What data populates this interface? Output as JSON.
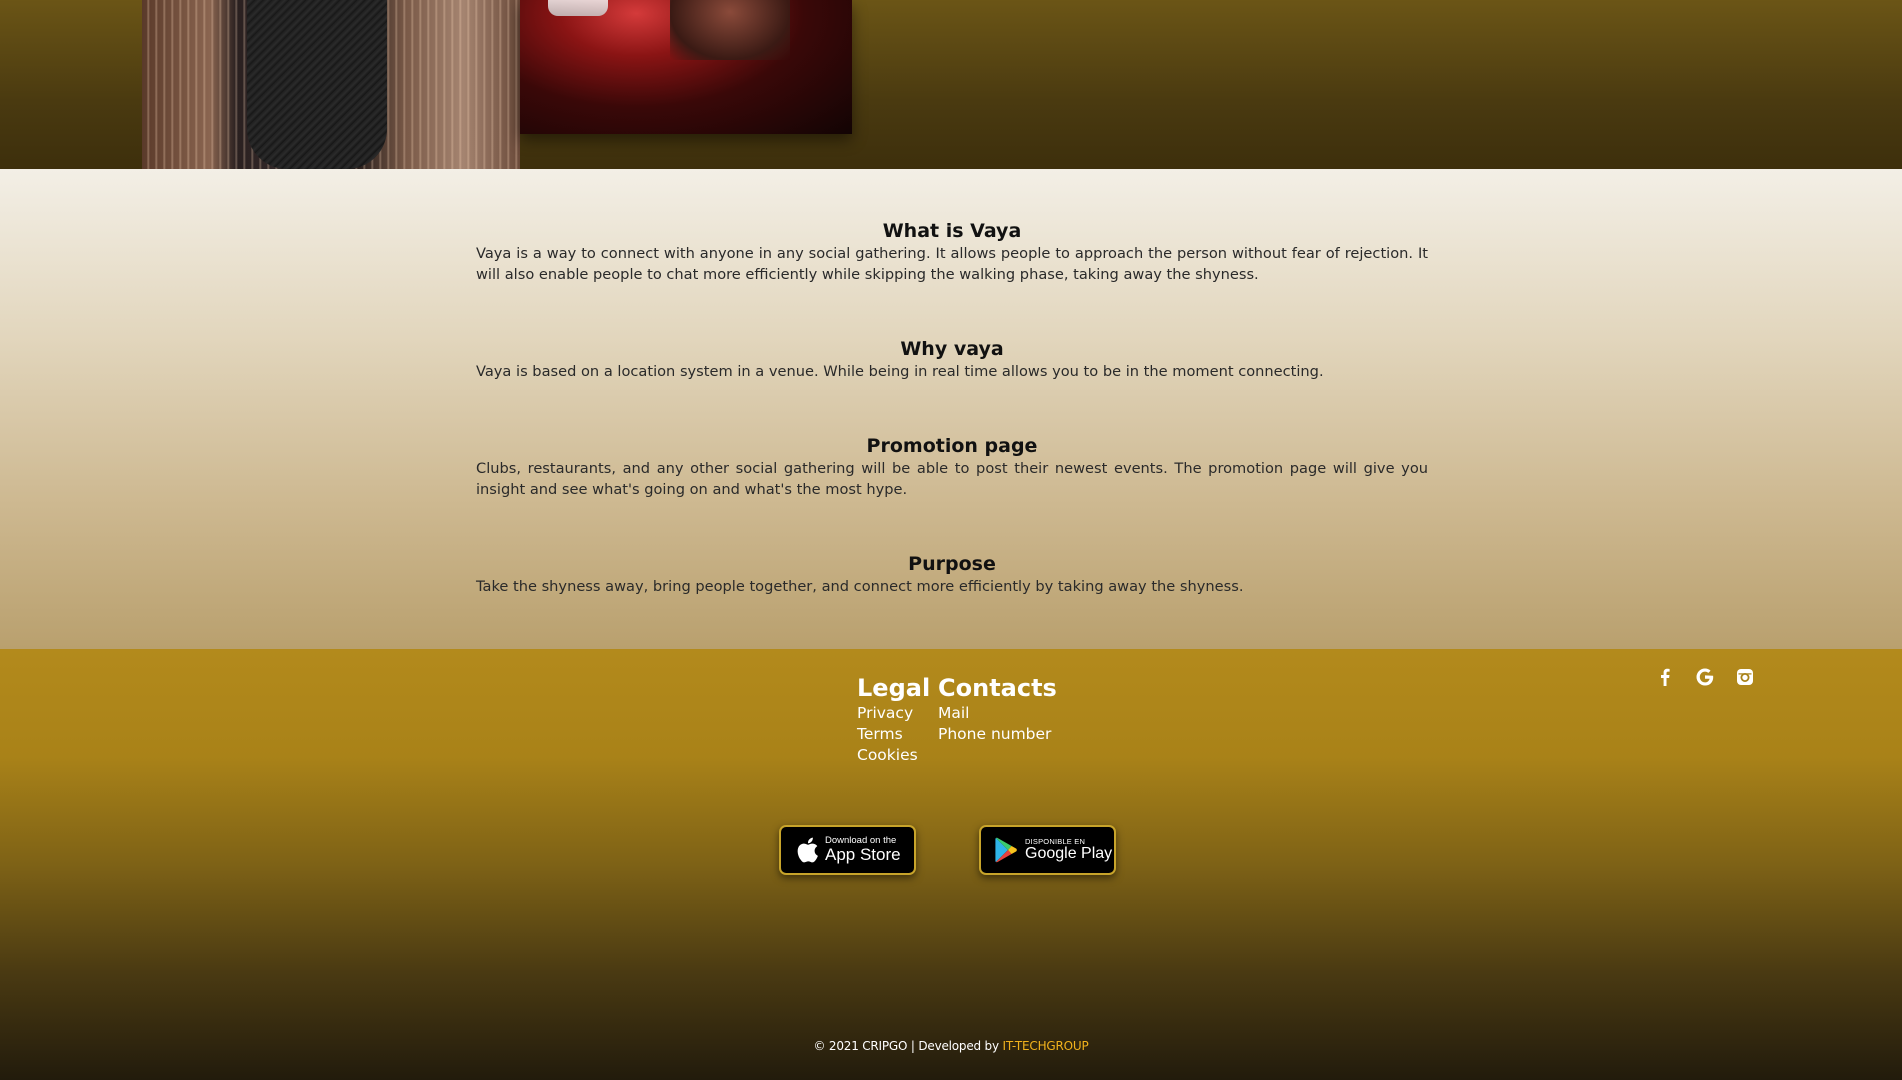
{
  "sections": [
    {
      "title": "What is Vaya",
      "text": "Vaya is a way to connect with anyone in any social gathering. It allows people to approach the person without fear of rejection. It will also enable people to chat more efficiently while skipping the walking phase, taking away the shyness."
    },
    {
      "title": "Why vaya",
      "text": "Vaya is based on a location system in a venue. While being in real time allows you to be in the moment connecting."
    },
    {
      "title": "Promotion page",
      "text": "Clubs, restaurants, and any other social gathering will be able to post their newest events. The promotion page will give you insight and see what's going on and what's the most hype."
    },
    {
      "title": "Purpose",
      "text": "Take the shyness away, bring people together, and connect more efficiently by taking away the shyness."
    }
  ],
  "footer": {
    "legal": {
      "heading": "Legal",
      "links": [
        "Privacy",
        "Terms",
        "Cookies"
      ]
    },
    "contacts": {
      "heading": "Contacts",
      "links": [
        "Mail",
        "Phone number"
      ]
    },
    "social_icons": [
      "facebook-icon",
      "google-icon",
      "instagram-icon"
    ],
    "app_store": {
      "small": "Download on the",
      "big": "App Store"
    },
    "google_play": {
      "small": "DISPONIBLE EN",
      "big": "Google Play"
    },
    "copyright": "© 2021 CRIPGO | Developed by",
    "developer": "IT-TECHGROUP"
  },
  "colors": {
    "footer_gold": "#b38a1c",
    "developer_link": "#f1b21c",
    "badge_border": "#c8a42a"
  }
}
